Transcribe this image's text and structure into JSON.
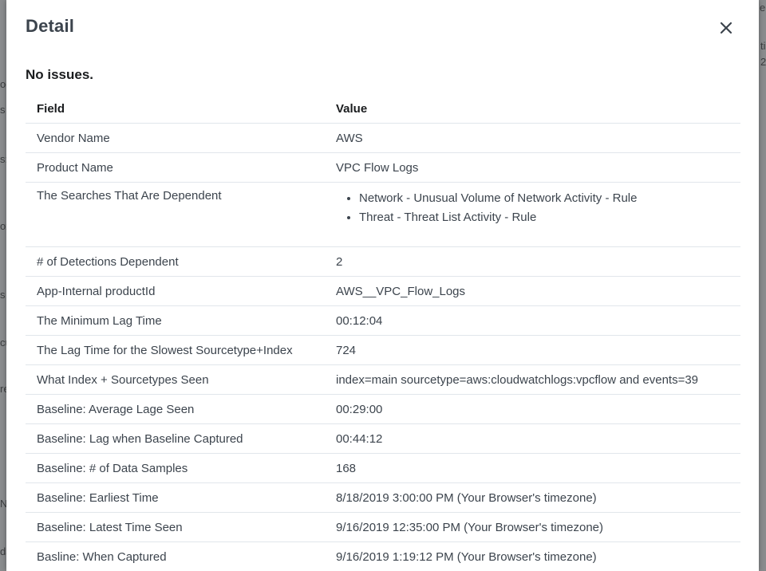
{
  "modal": {
    "title": "Detail",
    "close_icon": "close-icon",
    "status": "No issues."
  },
  "table": {
    "headers": {
      "field": "Field",
      "value": "Value"
    },
    "rows": [
      {
        "field": "Vendor Name",
        "value": "AWS"
      },
      {
        "field": "Product Name",
        "value": "VPC Flow Logs"
      },
      {
        "field": "The Searches That Are Dependent",
        "values": [
          "Network - Unusual Volume of Network Activity - Rule",
          "Threat - Threat List Activity - Rule"
        ]
      },
      {
        "field": "# of Detections Dependent",
        "value": "2"
      },
      {
        "field": "App-Internal productId",
        "value": "AWS__VPC_Flow_Logs"
      },
      {
        "field": "The Minimum Lag Time",
        "value": "00:12:04"
      },
      {
        "field": "The Lag Time for the Slowest Sourcetype+Index",
        "value": "724"
      },
      {
        "field": "What Index + Sourcetypes Seen",
        "value": "index=main sourcetype=aws:cloudwatchlogs:vpcflow and events=39"
      },
      {
        "field": "Baseline: Average Lage Seen",
        "value": "00:29:00"
      },
      {
        "field": "Baseline: Lag when Baseline Captured",
        "value": "00:44:12"
      },
      {
        "field": "Baseline: # of Data Samples",
        "value": "168"
      },
      {
        "field": "Baseline: Earliest Time",
        "value": "8/18/2019 3:00:00 PM (Your Browser's timezone)"
      },
      {
        "field": "Baseline: Latest Time Seen",
        "value": "9/16/2019 12:35:00 PM (Your Browser's timezone)"
      },
      {
        "field": "Basline: When Captured",
        "value": "9/16/2019 1:19:12 PM (Your Browser's timezone)"
      }
    ]
  },
  "backdrop": {
    "fragments": [
      "e",
      "ti",
      "2",
      "od",
      "s",
      "s:",
      "ox",
      "s",
      "cu",
      "re",
      "N",
      "da"
    ]
  }
}
